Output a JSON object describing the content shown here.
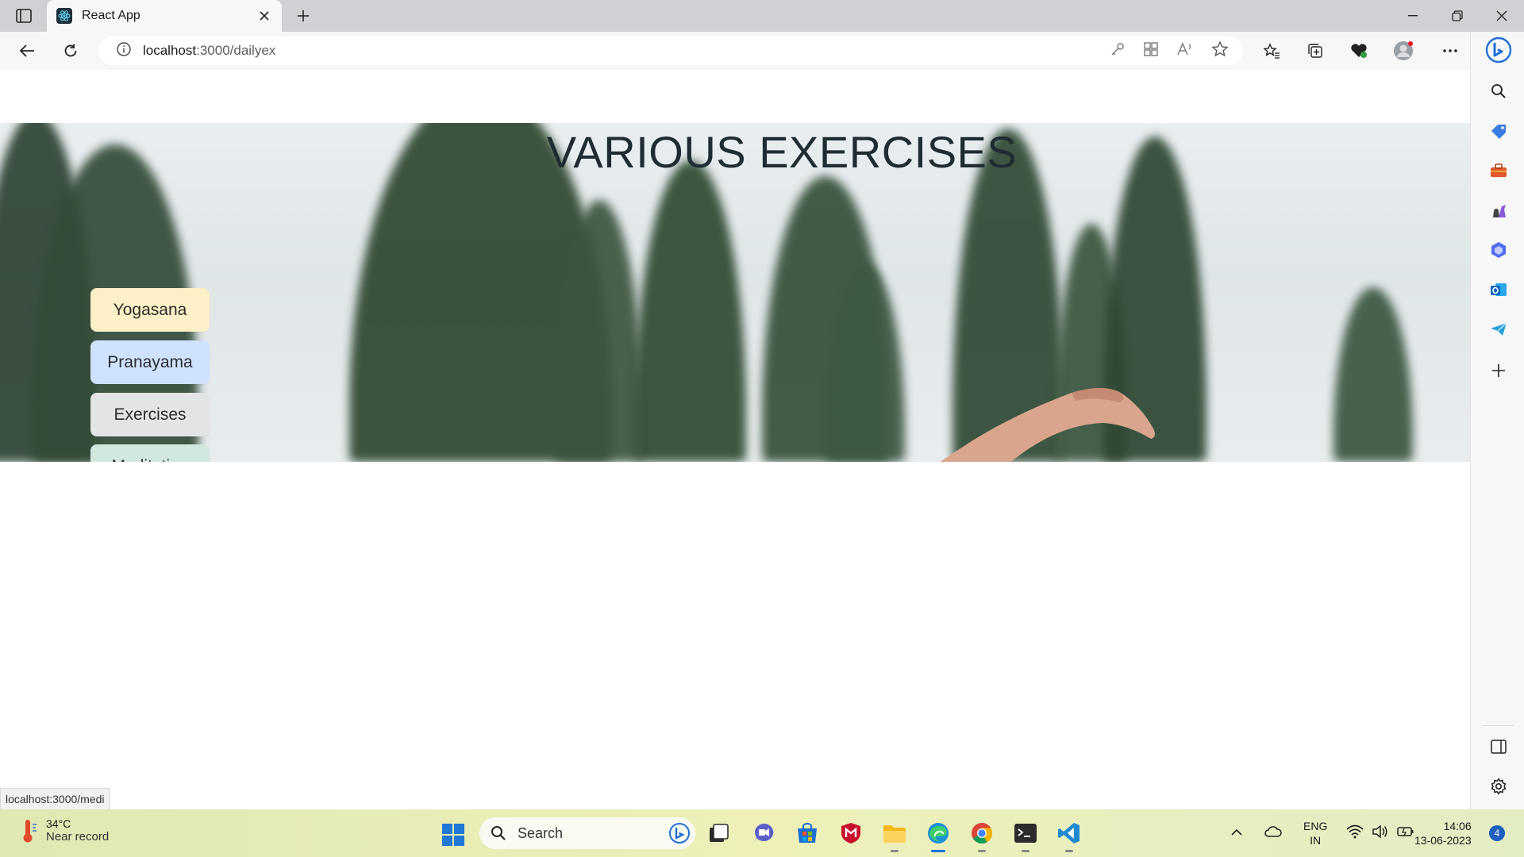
{
  "browser": {
    "tab_title": "React App",
    "url_host": "localhost",
    "url_rest": ":3000/dailyex",
    "status_url": "localhost:3000/medi"
  },
  "page": {
    "title": "VARIOUS EXERCISES",
    "menu": [
      {
        "label": "Yogasana",
        "color": "#fdf0c6"
      },
      {
        "label": "Pranayama",
        "color": "#cfe2ff"
      },
      {
        "label": "Exercises",
        "color": "#e4e4e6"
      },
      {
        "label": "Meditation",
        "color": "#d2e8df"
      }
    ],
    "close_glyph": "x"
  },
  "taskbar": {
    "weather_temp": "34°C",
    "weather_desc": "Near record",
    "search_label": "Search",
    "lang_line1": "ENG",
    "lang_line2": "IN",
    "time": "14:06",
    "date": "13-06-2023",
    "notification_count": "4"
  },
  "icons": {
    "tab_actions": "tab-actions-icon",
    "back": "back-arrow-icon",
    "refresh": "refresh-icon",
    "site_info": "info-icon",
    "favorites": "star-icon",
    "copilot": "bing-copilot-icon"
  }
}
